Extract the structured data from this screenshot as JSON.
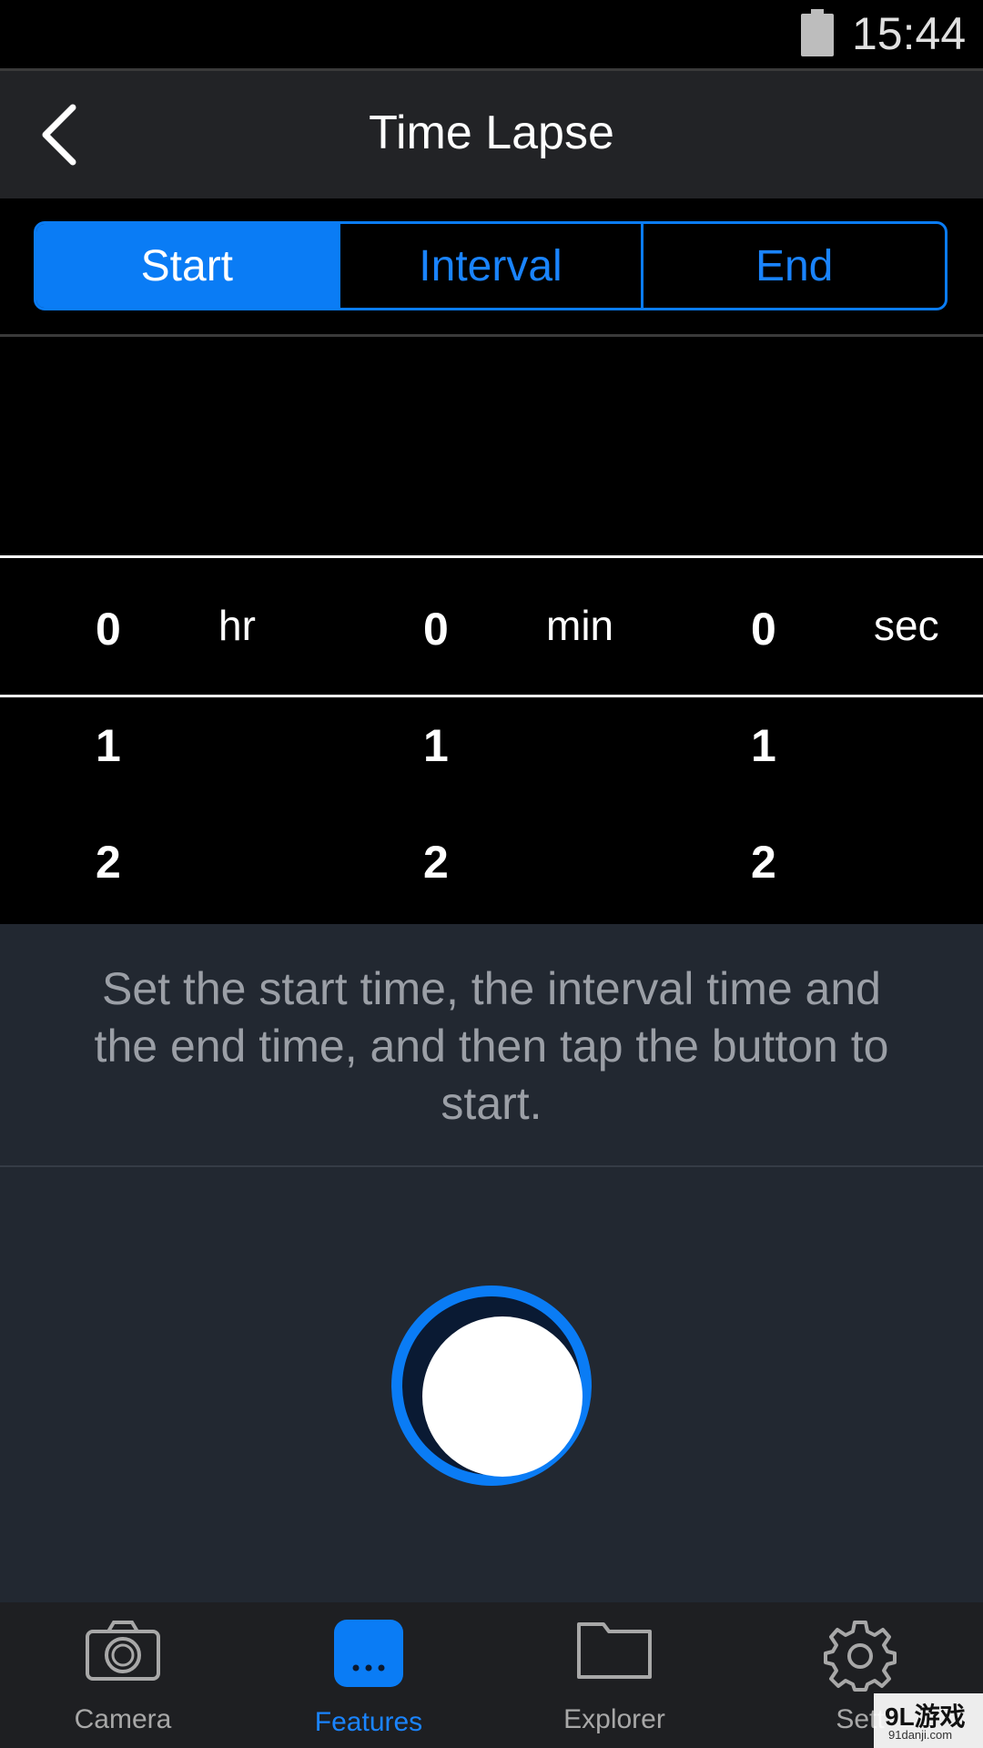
{
  "status_bar": {
    "time": "15:44",
    "battery_icon": "battery-icon"
  },
  "header": {
    "title": "Time Lapse",
    "back_icon": "chevron-left-icon"
  },
  "segments": [
    {
      "label": "Start",
      "active": true
    },
    {
      "label": "Interval",
      "active": false
    },
    {
      "label": "End",
      "active": false
    }
  ],
  "picker": {
    "hours": {
      "values": [
        "0",
        "1",
        "2"
      ],
      "unit": "hr"
    },
    "minutes": {
      "values": [
        "0",
        "1",
        "2"
      ],
      "unit": "min"
    },
    "seconds": {
      "values": [
        "0",
        "1",
        "2"
      ],
      "unit": "sec"
    }
  },
  "info_text": "Set the start time, the interval time and the end time, and then tap the button to start.",
  "tabs": [
    {
      "label": "Camera",
      "icon": "camera-icon",
      "active": false
    },
    {
      "label": "Features",
      "icon": "more-dots-icon",
      "active": true
    },
    {
      "label": "Explorer",
      "icon": "folder-icon",
      "active": false
    },
    {
      "label": "Sett",
      "icon": "gear-icon",
      "active": false
    }
  ],
  "watermark": {
    "logo": "9L游戏",
    "url": "91danji.com"
  },
  "colors": {
    "accent": "#0a7cf5",
    "panel": "#222831",
    "header": "#222326"
  }
}
